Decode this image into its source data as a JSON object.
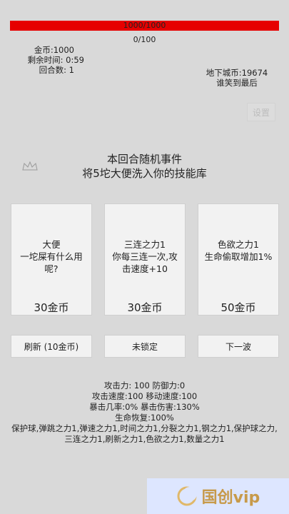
{
  "hp": {
    "text": "1000/1000",
    "fill": 1.0,
    "color": "#e60000"
  },
  "exp": {
    "text": "0/100"
  },
  "stats": {
    "gold": "金币:1000",
    "time": "剩余时间:  0:59",
    "round": "回合数:  1"
  },
  "city": {
    "coins": "地下城币:19674",
    "subtitle": "谁笑到最后"
  },
  "settings": {
    "label": "设置"
  },
  "event": {
    "title": "本回合随机事件",
    "text": "将5坨大便洗入你的技能库"
  },
  "cards": [
    {
      "desc": "大便\n一坨屎有什么用呢?",
      "price": "30金币"
    },
    {
      "desc": "三连之力1\n你每三连一次,攻击速度+10",
      "price": "30金币"
    },
    {
      "desc": "色欲之力1\n生命偷取增加1%",
      "price": "50金币"
    }
  ],
  "buttons": {
    "refresh": "刷新 (10金币)",
    "lock": "未锁定",
    "next": "下一波"
  },
  "attributes": {
    "line1": "攻击力:   100 防御力:0",
    "line2": "攻击速度:100 移动速度:100",
    "line3": "暴击几率:0% 暴击伤害:130%",
    "line4": "生命恢复:100%"
  },
  "skills": "保护球,弹跳之力1,弹速之力1,时间之力1,分裂之力1,钢之力1,保护球之力,三连之力1,刷新之力1,色欲之力1,数量之力1",
  "watermark": {
    "text": "国创vip",
    "icon": "moon-logo-icon"
  }
}
